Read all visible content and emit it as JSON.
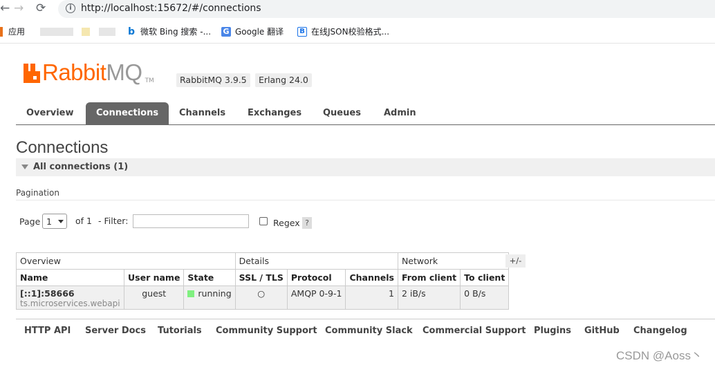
{
  "browser": {
    "url": "http://localhost:15672/#/connections",
    "bookmarks": [
      {
        "label": "应用",
        "icon": "apps-grid-icon"
      },
      {
        "label": "微软 Bing 搜索 -...",
        "icon": "bing-icon"
      },
      {
        "label": "Google 翻译",
        "icon": "google-translate-icon"
      },
      {
        "label": "在线JSON校验格式...",
        "icon": "json-b-icon"
      }
    ]
  },
  "app": {
    "logo_main": "Rabbit",
    "logo_mq": "MQ",
    "logo_tm": "TM",
    "rabbitmq_version": "RabbitMQ 3.9.5",
    "erlang_version": "Erlang 24.0",
    "brand_color": "#ff6600"
  },
  "tabs": [
    {
      "label": "Overview",
      "active": false
    },
    {
      "label": "Connections",
      "active": true
    },
    {
      "label": "Channels",
      "active": false
    },
    {
      "label": "Exchanges",
      "active": false
    },
    {
      "label": "Queues",
      "active": false
    },
    {
      "label": "Admin",
      "active": false
    }
  ],
  "page": {
    "title": "Connections",
    "section_label": "All connections (1)"
  },
  "pagination": {
    "title": "Pagination",
    "page_label": "Page",
    "page_value": "1",
    "of_label": "of 1",
    "filter_label": "- Filter:",
    "filter_value": "",
    "regex_label": "Regex",
    "regex_checked": false,
    "help_label": "?"
  },
  "table": {
    "groups": [
      "Overview",
      "Details",
      "Network"
    ],
    "toggle_label": "+/-",
    "headers": [
      "Name",
      "User name",
      "State",
      "SSL / TLS",
      "Protocol",
      "Channels",
      "From client",
      "To client"
    ],
    "rows": [
      {
        "name": "[::1]:58666",
        "client_name": "ts.microservices.webapi",
        "user": "guest",
        "state": "running",
        "ssl": "○",
        "protocol": "AMQP 0-9-1",
        "channels": "1",
        "from_client": "2 iB/s",
        "to_client": "0 B/s"
      }
    ],
    "state_color": "#80f080"
  },
  "footer": {
    "links": [
      "HTTP API",
      "Server Docs",
      "Tutorials",
      "Community Support",
      "Community Slack",
      "Commercial Support",
      "Plugins",
      "GitHub",
      "Changelog"
    ]
  },
  "watermark": "CSDN @Aoss丶"
}
